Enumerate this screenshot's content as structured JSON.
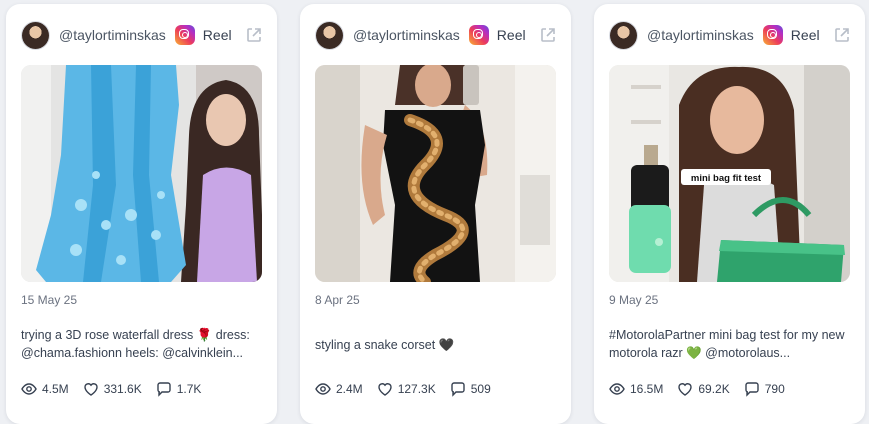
{
  "cards": [
    {
      "handle": "@taylortiminskas",
      "platform_icon": "instagram-icon",
      "type_label": "Reel",
      "date": "15 May 25",
      "caption": "trying a 3D rose waterfall dress 🌹 dress: @chama.fashionn heels: @calvinklein...",
      "stats": {
        "views": "4.5M",
        "likes": "331.6K",
        "comments": "1.7K"
      }
    },
    {
      "handle": "@taylortiminskas",
      "platform_icon": "instagram-icon",
      "type_label": "Reel",
      "date": "8 Apr 25",
      "caption": "styling a snake corset 🖤",
      "stats": {
        "views": "2.4M",
        "likes": "127.3K",
        "comments": "509"
      }
    },
    {
      "handle": "@taylortiminskas",
      "platform_icon": "instagram-icon",
      "type_label": "Reel",
      "date": "9 May 25",
      "caption": "#MotorolaPartner mini bag test for my new motorola razr 💚 @motorolaus...",
      "overlay_text": "mini bag fit test",
      "stats": {
        "views": "16.5M",
        "likes": "69.2K",
        "comments": "790"
      }
    }
  ],
  "colors": {
    "accent_text": "#374151",
    "muted_text": "#6b7280",
    "card_bg": "#ffffff",
    "page_bg": "#eef0f4"
  }
}
